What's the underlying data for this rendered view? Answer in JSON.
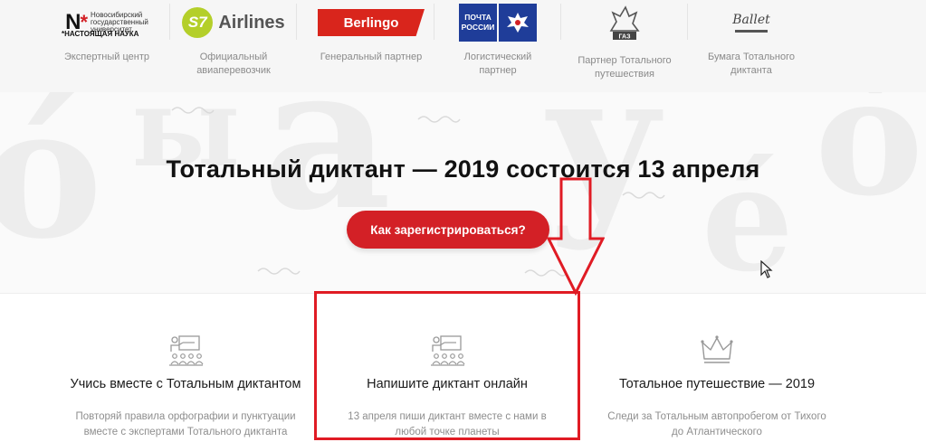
{
  "partners": [
    {
      "logo_lines": [
        "Новосибирский",
        "государственный",
        "университет",
        "*НАСТОЯЩАЯ НАУКА"
      ],
      "caption": "Экспертный центр",
      "icon": "nsu-logo"
    },
    {
      "logo_text": "Airlines",
      "logo_badge": "S7",
      "caption": "Официальный авиаперевозчик",
      "icon": "s7-logo"
    },
    {
      "logo_text": "Berlingo",
      "caption": "Генеральный партнер",
      "icon": "berlingo-logo"
    },
    {
      "logo_lines": [
        "ПОЧТА",
        "РОССИИ"
      ],
      "caption": "Логистический партнер",
      "icon": "russian-post-logo"
    },
    {
      "logo_text": "ГАЗ",
      "caption": "Партнер Тотального путешествия",
      "icon": "gaz-logo"
    },
    {
      "logo_text": "Ballet",
      "caption": "Бумага Тотального диктанта",
      "icon": "ballet-logo"
    }
  ],
  "hero": {
    "title": "Тотальный диктант — 2019 состоится 13 апреля",
    "register_button": "Как зарегистрироваться?"
  },
  "cards": [
    {
      "title": "Учись вместе с Тотальным диктантом",
      "desc_line1": "Повторяй правила орфографии и пунктуации",
      "desc_line2": "вместе с экспертами Тотального диктанта",
      "icon": "classroom-icon"
    },
    {
      "title": "Напишите диктант онлайн",
      "desc_line1": "13 апреля пиши диктант вместе с нами в",
      "desc_line2": "любой точке планеты",
      "icon": "classroom-icon"
    },
    {
      "title": "Тотальное путешествие — 2019",
      "desc_line1": "Следи за Тотальным автопробегом от Тихого",
      "desc_line2": "до Атлантического",
      "icon": "crown-icon"
    }
  ],
  "colors": {
    "accent": "#d32026",
    "annotation": "#e01b24",
    "muted": "#8e8e8e"
  }
}
